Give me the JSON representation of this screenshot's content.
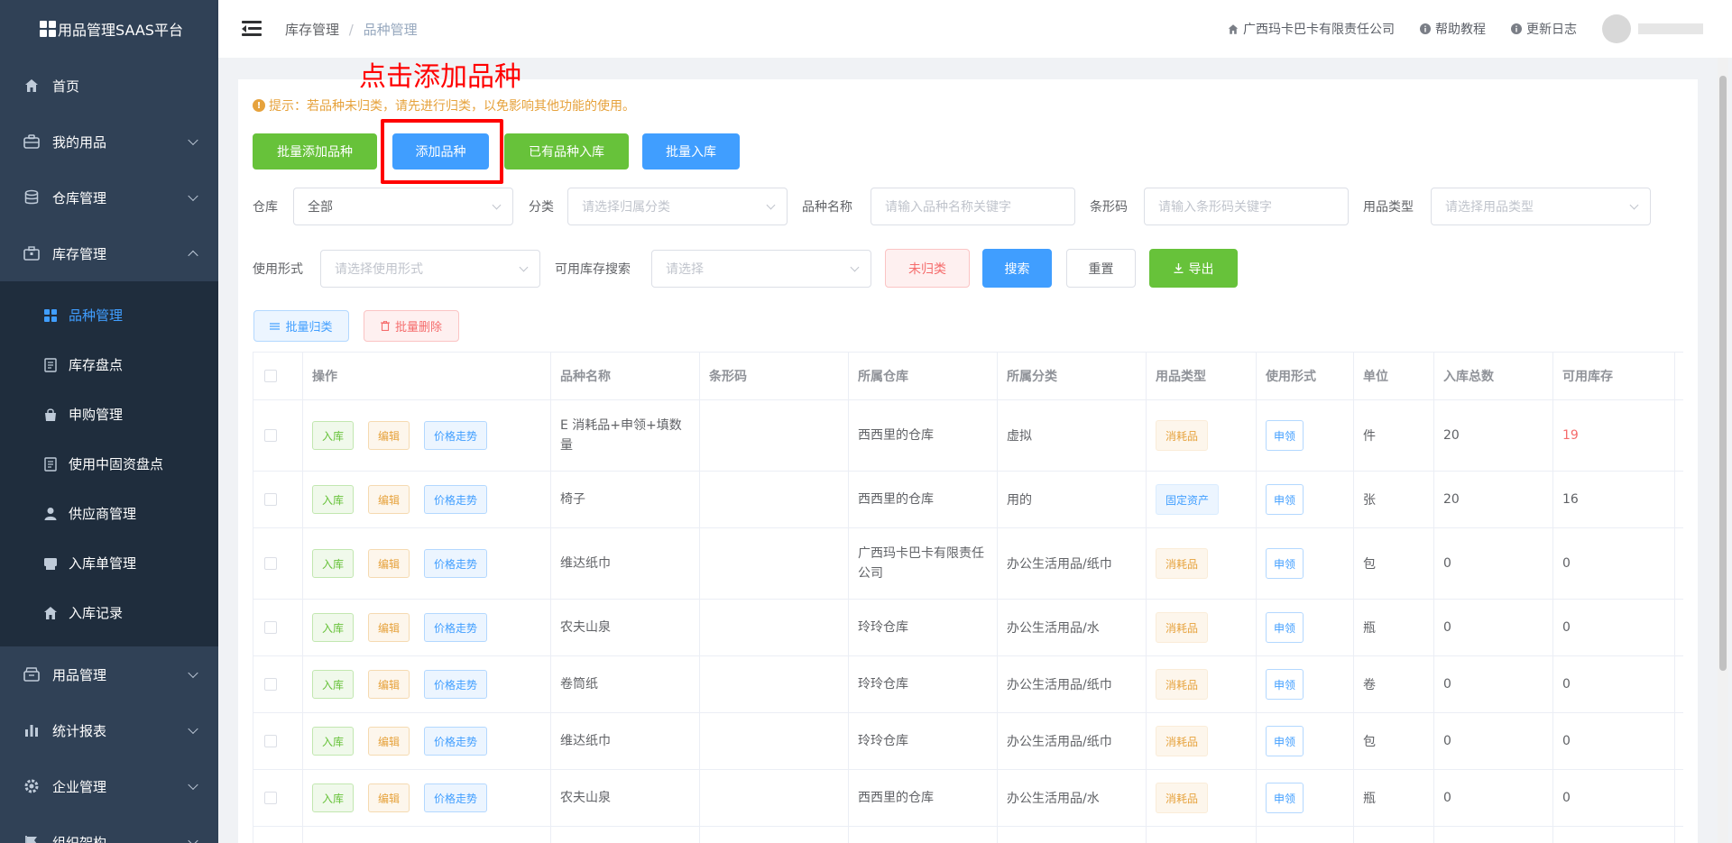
{
  "app": {
    "title": "用品管理SAAS平台"
  },
  "sidebar": {
    "items": [
      {
        "label": "首页",
        "icon": "home-icon"
      },
      {
        "label": "我的用品",
        "icon": "briefcase-icon"
      },
      {
        "label": "仓库管理",
        "icon": "database-icon"
      },
      {
        "label": "库存管理",
        "icon": "box-icon"
      }
    ],
    "sub_items": [
      {
        "label": "品种管理",
        "icon": "grid-icon",
        "active": true
      },
      {
        "label": "库存盘点",
        "icon": "document-icon"
      },
      {
        "label": "申购管理",
        "icon": "bag-icon"
      },
      {
        "label": "使用中固资盘点",
        "icon": "document-icon"
      },
      {
        "label": "供应商管理",
        "icon": "user-icon"
      },
      {
        "label": "入库单管理",
        "icon": "printer-icon"
      },
      {
        "label": "入库记录",
        "icon": "home-icon"
      }
    ],
    "bottom_items": [
      {
        "label": "用品管理",
        "icon": "archive-icon"
      },
      {
        "label": "统计报表",
        "icon": "chart-icon"
      },
      {
        "label": "企业管理",
        "icon": "gear-icon"
      },
      {
        "label": "组织架构",
        "icon": "flag-icon"
      }
    ]
  },
  "header": {
    "breadcrumb": [
      "库存管理",
      "品种管理"
    ],
    "company": "广西玛卡巴卡有限责任公司",
    "help": "帮助教程",
    "changelog": "更新日志"
  },
  "annotation": {
    "text": "点击添加品种",
    "color": "#ff0000"
  },
  "tip": "提示：若品种未归类，请先进行归类，以免影响其他功能的使用。",
  "buttons": {
    "batch_add": "批量添加品种",
    "add": "添加品种",
    "existing_in": "已有品种入库",
    "batch_in": "批量入库",
    "unclassified": "未归类",
    "search": "搜索",
    "reset": "重置",
    "export": "导出",
    "batch_classify": "批量归类",
    "batch_delete": "批量删除"
  },
  "filters": {
    "warehouse": {
      "label": "仓库",
      "value": "全部"
    },
    "category": {
      "label": "分类",
      "placeholder": "请选择归属分类"
    },
    "name": {
      "label": "品种名称",
      "placeholder": "请输入品种名称关键字"
    },
    "barcode": {
      "label": "条形码",
      "placeholder": "请输入条形码关键字"
    },
    "type": {
      "label": "用品类型",
      "placeholder": "请选择用品类型"
    },
    "usage": {
      "label": "使用形式",
      "placeholder": "请选择使用形式"
    },
    "stock": {
      "label": "可用库存搜索",
      "placeholder": "请选择"
    }
  },
  "table": {
    "headers": [
      "操作",
      "品种名称",
      "条形码",
      "所属仓库",
      "所属分类",
      "用品类型",
      "使用形式",
      "单位",
      "入库总数",
      "可用库存"
    ],
    "action_labels": {
      "in": "入库",
      "edit": "编辑",
      "trend": "价格走势"
    },
    "rows": [
      {
        "name": "E 消耗品+申领+填数量",
        "barcode": "",
        "warehouse": "西西里的仓库",
        "category": "虚拟",
        "type": "消耗品",
        "usage": "申领",
        "unit": "件",
        "total": "20",
        "available": "19"
      },
      {
        "name": "椅子",
        "barcode": "",
        "warehouse": "西西里的仓库",
        "category": "用的",
        "type": "固定资产",
        "usage": "申领",
        "unit": "张",
        "total": "20",
        "available": "16"
      },
      {
        "name": "维达纸巾",
        "barcode": "",
        "warehouse": "广西玛卡巴卡有限责任公司",
        "category": "办公生活用品/纸巾",
        "type": "消耗品",
        "usage": "申领",
        "unit": "包",
        "total": "0",
        "available": "0"
      },
      {
        "name": "农夫山泉",
        "barcode": "",
        "warehouse": "玲玲仓库",
        "category": "办公生活用品/水",
        "type": "消耗品",
        "usage": "申领",
        "unit": "瓶",
        "total": "0",
        "available": "0"
      },
      {
        "name": "卷筒纸",
        "barcode": "",
        "warehouse": "玲玲仓库",
        "category": "办公生活用品/纸巾",
        "type": "消耗品",
        "usage": "申领",
        "unit": "卷",
        "total": "0",
        "available": "0"
      },
      {
        "name": "维达纸巾",
        "barcode": "",
        "warehouse": "玲玲仓库",
        "category": "办公生活用品/纸巾",
        "type": "消耗品",
        "usage": "申领",
        "unit": "包",
        "total": "0",
        "available": "0"
      },
      {
        "name": "农夫山泉",
        "barcode": "",
        "warehouse": "西西里的仓库",
        "category": "办公生活用品/水",
        "type": "消耗品",
        "usage": "申领",
        "unit": "瓶",
        "total": "0",
        "available": "0"
      }
    ]
  },
  "colors": {
    "sidebar_bg": "#304156",
    "primary": "#409eff",
    "success": "#67c23a",
    "warning": "#e6a23c",
    "danger": "#f56c6c"
  }
}
